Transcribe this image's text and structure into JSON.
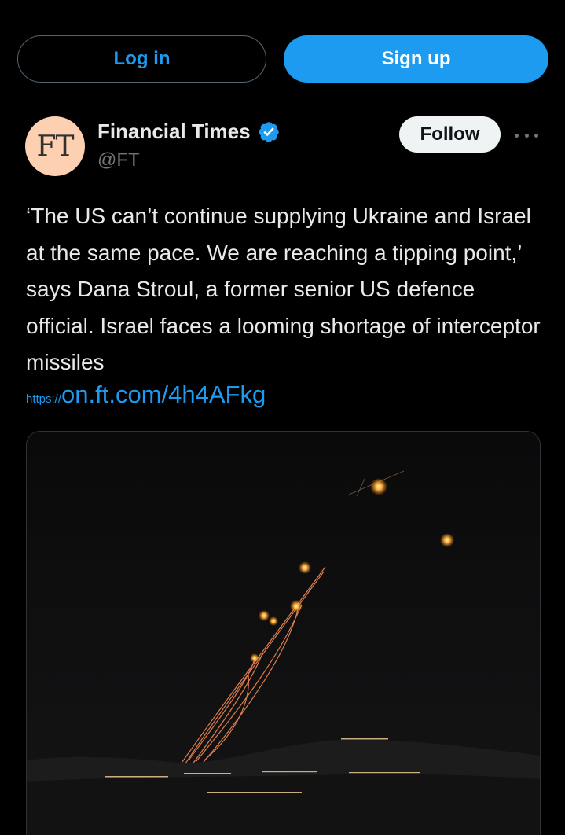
{
  "auth": {
    "login_label": "Log in",
    "signup_label": "Sign up"
  },
  "tweet": {
    "author": {
      "name": "Financial Times",
      "handle": "@FT",
      "avatar_text": "FT",
      "verified": true
    },
    "follow_label": "Follow",
    "text": "‘The US can’t continue supplying Ukraine and Israel at the same pace. We are reaching a tipping point,’ says Dana Stroul, a former senior US defence official. Israel faces a looming shortage of interceptor missiles",
    "link": {
      "protocol": "https://",
      "display": "on.ft.com/4h4AFkg"
    },
    "media": {
      "icon": "night-sky-photo-icon"
    }
  },
  "colors": {
    "background": "#000000",
    "accent": "#1d9bf0",
    "text_primary": "#e7e9ea",
    "text_secondary": "#71767b",
    "avatar_bg": "#fcd0b1",
    "follow_bg": "#eff3f4"
  }
}
